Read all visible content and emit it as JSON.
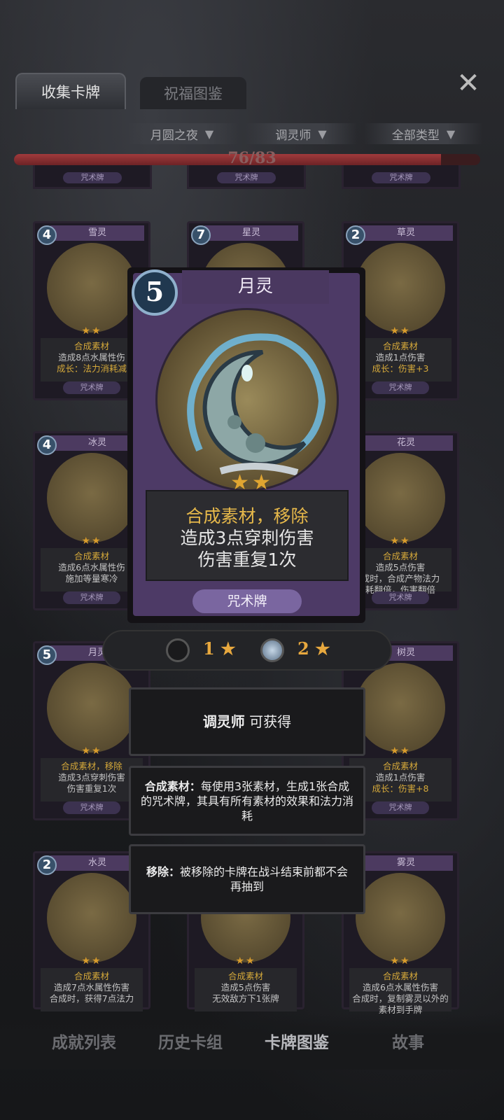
{
  "tabs": [
    {
      "label": "收集卡牌"
    },
    {
      "label": "祝福图鉴"
    }
  ],
  "filters": [
    {
      "label": "月圆之夜"
    },
    {
      "label": "调灵师"
    },
    {
      "label": "全部类型"
    }
  ],
  "progress": {
    "text": "76/83",
    "value": 0.9157
  },
  "grid": [
    {
      "cost": "4",
      "name": "雪灵",
      "stars": "★★",
      "line1": "合成素材",
      "line2": "造成8点水属性伤",
      "line3": "成长：法力消耗减",
      "type": "咒术牌"
    },
    {
      "cost": "7",
      "name": "星灵",
      "stars": "",
      "line1": "",
      "line2": "",
      "line3": "",
      "type": "咒术牌"
    },
    {
      "cost": "2",
      "name": "草灵",
      "stars": "★★",
      "line1": "合成素材",
      "line2": "造成1点伤害",
      "line3": "成长：伤害+3",
      "type": "咒术牌"
    },
    {
      "cost": "4",
      "name": "冰灵",
      "stars": "★★",
      "line1": "合成素材",
      "line2": "造成6点水属性伤",
      "line3": "施加等量寒冷",
      "type": "咒术牌"
    },
    {
      "cost": "",
      "name": "花灵",
      "stars": "★★",
      "line1": "合成素材",
      "line2": "造成5点伤害",
      "line3": "成时，合成产物法力",
      "line4": "耗翻倍，伤害翻倍",
      "type": "咒术牌"
    },
    {
      "cost": "5",
      "name": "月灵",
      "stars": "★★",
      "line1": "合成素材，移除",
      "line2": "造成3点穿刺伤害",
      "line3": "伤害重复1次",
      "type": "咒术牌"
    },
    {
      "cost": "4",
      "name": "树灵",
      "stars": "★★",
      "line1": "合成素材",
      "line2": "造成1点伤害",
      "line3": "成长：伤害+8",
      "type": "咒术牌"
    },
    {
      "cost": "2",
      "name": "水灵",
      "stars": "★★",
      "line1": "合成素材",
      "line2": "造成7点水属性伤害",
      "line3": "合成时，获得7点法力",
      "type": ""
    },
    {
      "cost": "",
      "name": "",
      "stars": "★★",
      "line1": "合成素材",
      "line2": "造成5点伤害",
      "line3": "无效敌方下1张牌",
      "type": ""
    },
    {
      "cost": "",
      "name": "雾灵",
      "stars": "★★",
      "line1": "合成素材",
      "line2": "造成6点水属性伤害",
      "line3": "合成时，复制雾灵以外的",
      "line4": "素材到手牌",
      "type": ""
    }
  ],
  "top_partial_types": [
    "咒术牌",
    "咒术牌",
    "咒术牌"
  ],
  "detail": {
    "cost": "5",
    "name": "月灵",
    "stars": "★★",
    "line1": "合成素材，移除",
    "line2": "造成3点穿刺伤害",
    "line3": "伤害重复1次",
    "type": "咒术牌"
  },
  "star_levels": [
    {
      "value": "1",
      "star": "★"
    },
    {
      "value": "2",
      "star": "★"
    }
  ],
  "info": {
    "obtain": {
      "who": "调灵师",
      "suffix": "可获得"
    },
    "term1": {
      "name": "合成素材：",
      "desc": "每使用3张素材，生成1张合成的咒术牌，其具有所有素材的效果和法力消耗"
    },
    "term2": {
      "name": "移除：",
      "desc": "被移除的卡牌在战斗结束前都不会再抽到"
    }
  },
  "nav": [
    {
      "label": "成就列表"
    },
    {
      "label": "历史卡组"
    },
    {
      "label": "卡牌图鉴"
    },
    {
      "label": "故事"
    }
  ],
  "icons": {
    "close": "close-icon",
    "filter": "funnel-icon"
  }
}
